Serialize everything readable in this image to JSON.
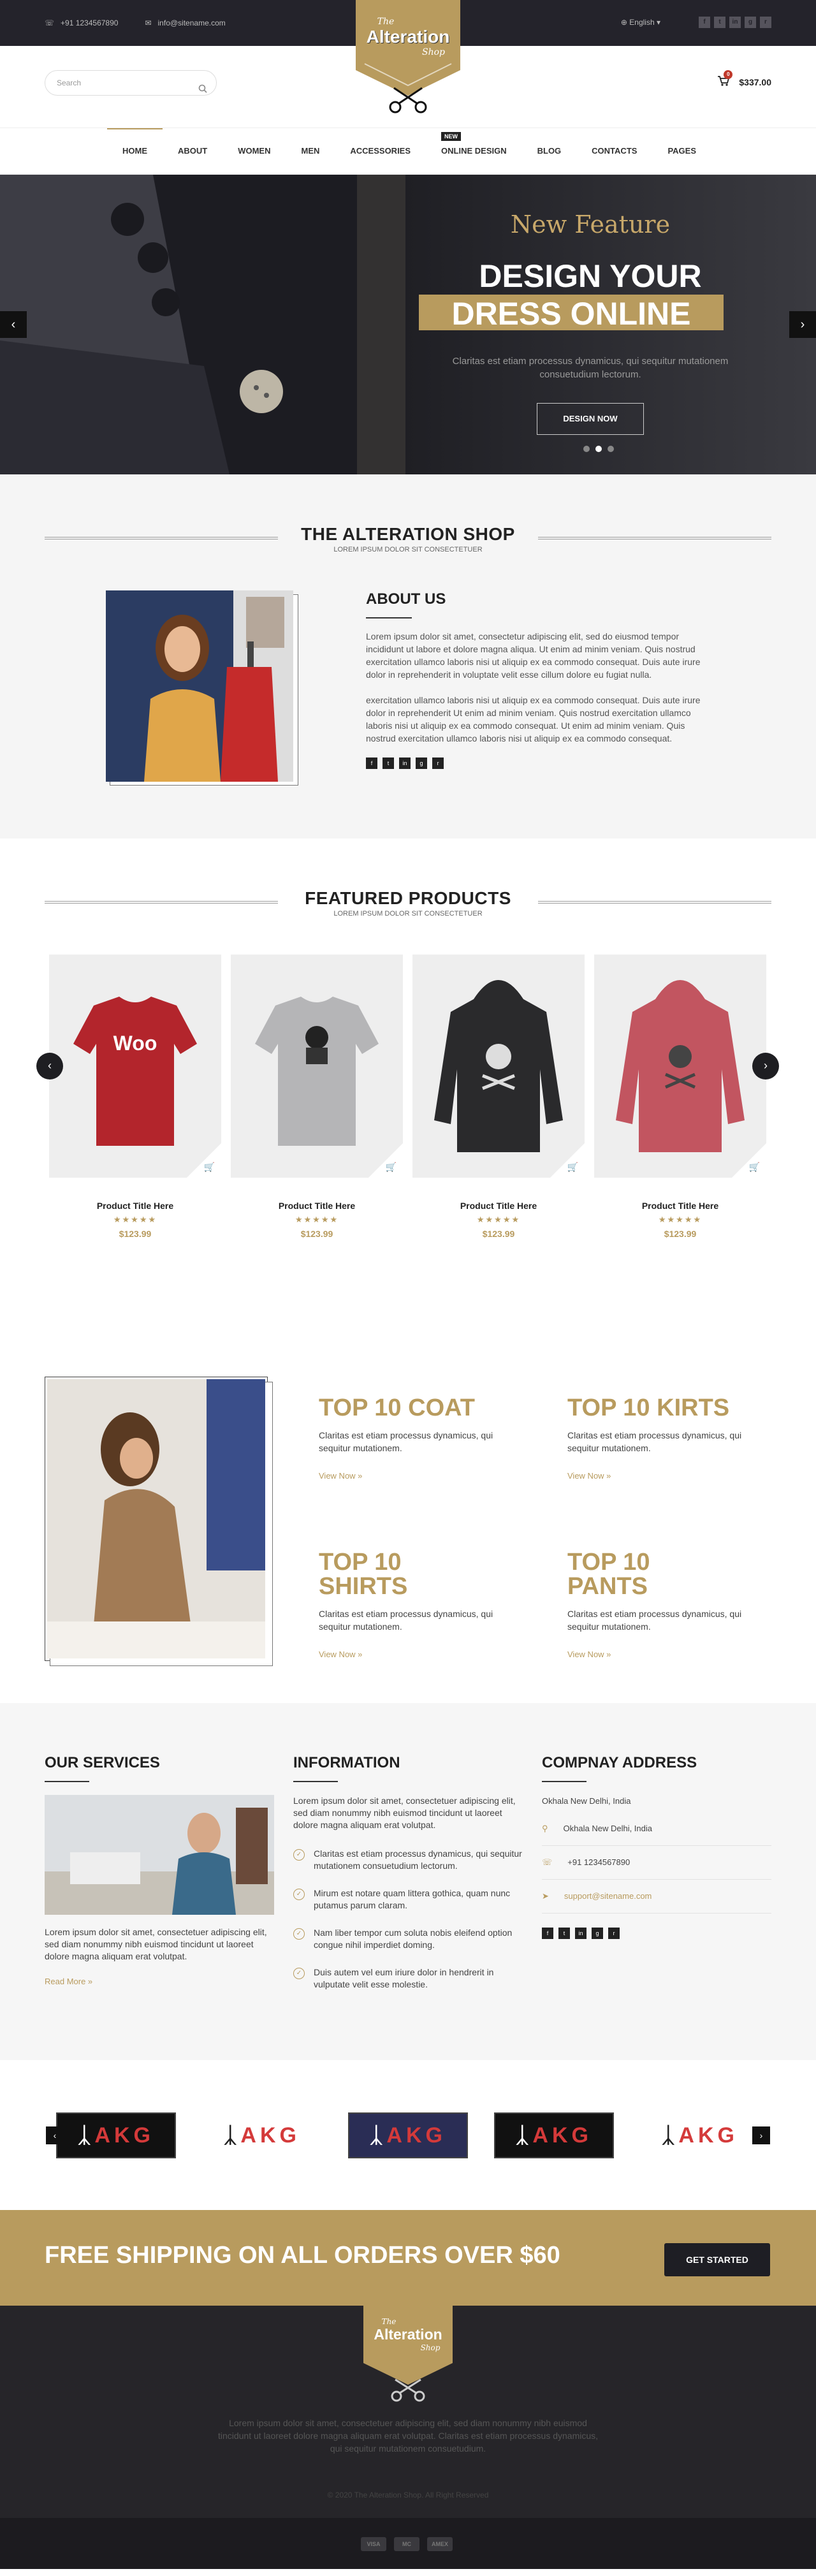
{
  "topbar": {
    "phone": "+91 1234567890",
    "email": "info@sitename.com",
    "language": "English",
    "social": [
      "f",
      "t",
      "in",
      "g",
      "r"
    ]
  },
  "logo": {
    "line1": "The",
    "line2": "Alteration",
    "line3": "Shop"
  },
  "header": {
    "search_placeholder": "Search",
    "cart_count": "0",
    "cart_total": "$337.00"
  },
  "nav": {
    "items": [
      "HOME",
      "ABOUT",
      "WOMEN",
      "MEN",
      "ACCESSORIES",
      "ONLINE DESIGN",
      "BLOG",
      "CONTACTS",
      "PAGES"
    ],
    "new_badge": "New"
  },
  "hero": {
    "eyebrow": "New Feature",
    "title1": "DESIGN YOUR",
    "title2": "DRESS ONLINE",
    "text": "Claritas est etiam processus dynamicus, qui sequitur mutationem consuetudium lectorum.",
    "button": "DESIGN NOW",
    "prev": "‹",
    "next": "›"
  },
  "shop": {
    "title": "THE ALTERATION SHOP",
    "subtitle": "LOREM IPSUM DOLOR SIT CONSECTETUER",
    "about_title": "ABOUT US",
    "p1": "Lorem ipsum dolor sit amet, consectetur adipiscing elit, sed do eiusmod tempor incididunt ut labore et dolore magna aliqua. Ut enim ad minim veniam. Quis nostrud exercitation ullamco laboris nisi ut aliquip ex ea commodo consequat. Duis aute irure dolor in reprehenderit in voluptate velit esse cillum dolore eu fugiat nulla.",
    "p2": "exercitation ullamco laboris nisi ut aliquip ex ea commodo consequat. Duis aute irure dolor in reprehenderit Ut enim ad minim veniam. Quis nostrud exercitation ullamco laboris nisi ut aliquip ex ea commodo consequat. Ut enim ad minim veniam. Quis nostrud exercitation ullamco laboris nisi ut aliquip ex ea commodo consequat."
  },
  "products": {
    "title": "FEATURED PRODUCTS",
    "subtitle": "LOREM IPSUM DOLOR SIT CONSECTETUER",
    "items": [
      {
        "name": "Product Title Here",
        "stars": "★★★★★",
        "price": "$123.99",
        "label": "Woo"
      },
      {
        "name": "Product Title Here",
        "stars": "★★★★★",
        "price": "$123.99"
      },
      {
        "name": "Product Title Here",
        "stars": "★★★★★",
        "price": "$123.99"
      },
      {
        "name": "Product Title Here",
        "stars": "★★★★★",
        "price": "$123.99"
      }
    ]
  },
  "categories": [
    {
      "title": "TOP 10 COAT",
      "text": "Claritas est etiam processus dynamicus, qui sequitur mutationem.",
      "link": "View Now »"
    },
    {
      "title": "TOP 10 KIRTS",
      "text": "Claritas est etiam processus dynamicus, qui sequitur mutationem.",
      "link": "View Now »"
    },
    {
      "title": "TOP 10 SHIRTS",
      "text": "Claritas est etiam processus dynamicus, qui sequitur mutationem.",
      "link": "View Now »"
    },
    {
      "title": "TOP 10 PANTS",
      "text": "Claritas est etiam processus dynamicus, qui sequitur mutationem.",
      "link": "View Now »"
    }
  ],
  "services": {
    "title": "OUR SERVICES",
    "text": "Lorem ipsum dolor sit amet, consectetuer adipiscing elit, sed diam nonummy nibh euismod tincidunt ut laoreet dolore magna aliquam erat volutpat.",
    "link": "Read More »"
  },
  "information": {
    "title": "INFORMATION",
    "intro": "Lorem ipsum dolor sit amet, consectetuer adipiscing elit, sed diam nonummy nibh euismod tincidunt ut laoreet dolore magna aliquam erat volutpat.",
    "items": [
      "Claritas est etiam processus dynamicus, qui sequitur mutationem consuetudium lectorum.",
      "Mirum est notare quam littera gothica, quam nunc putamus parum claram.",
      "Nam liber tempor cum soluta nobis eleifend option congue nihil imperdiet doming.",
      "Duis autem vel eum iriure dolor in hendrerit in vulputate velit esse molestie."
    ]
  },
  "address": {
    "title": "COMPNAY ADDRESS",
    "intro": "Okhala New Delhi, India",
    "location": "Okhala New Delhi, India",
    "phone": "+91 1234567890",
    "email": "support@sitename.com"
  },
  "brands": {
    "label": "AKG"
  },
  "shipping": {
    "text": "FREE SHIPPING ON ALL ORDERS OVER $60",
    "button": "GET STARTED"
  },
  "footer": {
    "text": "Lorem ipsum dolor sit amet, consectetuer adipiscing elit, sed diam nonummy nibh euismod tincidunt ut laoreet dolore magna aliquam erat volutpat. Claritas est etiam processus dynamicus, qui sequitur mutationem consuetudium.",
    "copyright": "© 2020 The Alteration Shop. All Right Reserved",
    "payments": [
      "VISA",
      "MC",
      "AMEX"
    ]
  },
  "colors": {
    "accent": "#b89b5e",
    "dark": "#24232b"
  }
}
